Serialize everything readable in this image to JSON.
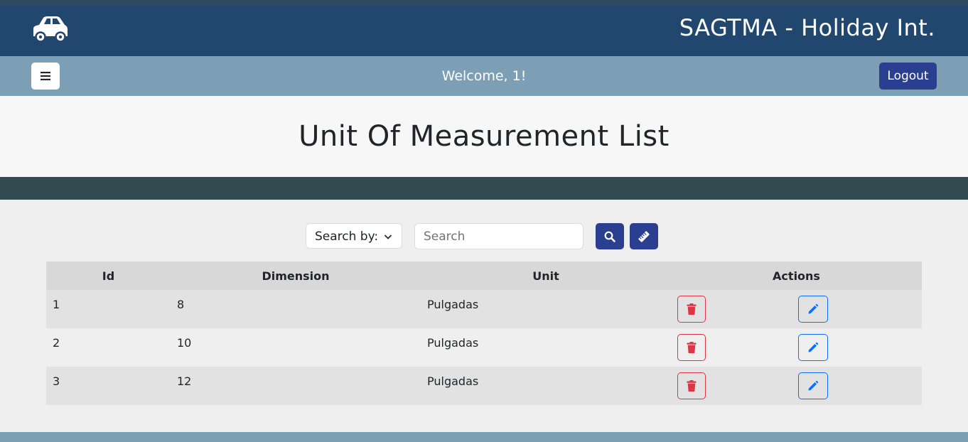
{
  "header": {
    "brand": "SAGTMA - Holiday Int.",
    "logo_icon": "car-icon"
  },
  "navbar": {
    "menu_icon": "hamburger-icon",
    "welcome": "Welcome, 1!",
    "logout_label": "Logout"
  },
  "page": {
    "title": "Unit Of Measurement List"
  },
  "search": {
    "select_label": "Search by:",
    "placeholder": "Search",
    "value": "",
    "search_icon": "search-icon",
    "ruler_icon": "ruler-icon"
  },
  "table": {
    "headers": [
      "Id",
      "Dimension",
      "Unit",
      "Actions"
    ],
    "rows": [
      {
        "id": "1",
        "dimension": "8",
        "unit": "Pulgadas"
      },
      {
        "id": "2",
        "dimension": "10",
        "unit": "Pulgadas"
      },
      {
        "id": "3",
        "dimension": "12",
        "unit": "Pulgadas"
      }
    ],
    "delete_icon": "trash-icon",
    "edit_icon": "pencil-icon"
  },
  "colors": {
    "header_bg": "#22476e",
    "navbar_bg": "#7d9fb5",
    "primary": "#2a3f8f",
    "danger": "#dc3545",
    "edit": "#0d6efd",
    "band_dark": "#344a51"
  }
}
